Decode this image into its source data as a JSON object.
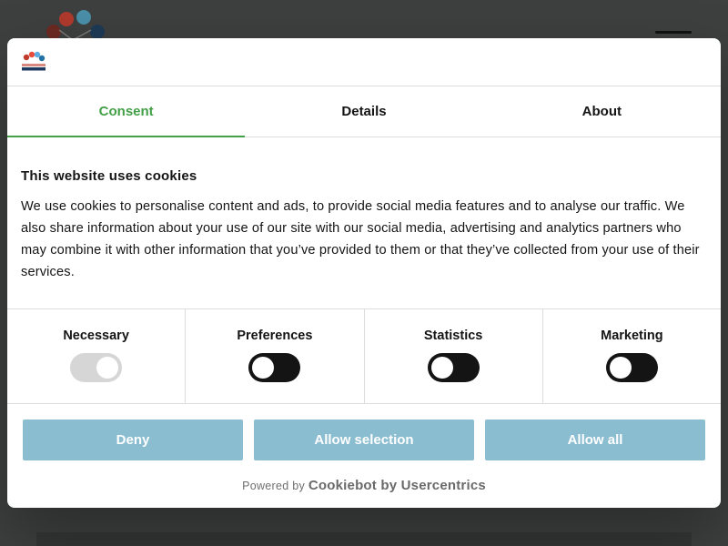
{
  "tabs": [
    {
      "label": "Consent",
      "active": true
    },
    {
      "label": "Details",
      "active": false
    },
    {
      "label": "About",
      "active": false
    }
  ],
  "content": {
    "title": "This website uses cookies",
    "body": "We use cookies to personalise content and ads, to provide social media features and to analyse our traffic. We also share information about your use of our site with our social media, advertising and analytics partners who may combine it with other information that you’ve provided to them or that they’ve collected from your use of their services."
  },
  "toggles": [
    {
      "label": "Necessary",
      "checked": true,
      "disabled": true
    },
    {
      "label": "Preferences",
      "checked": false,
      "disabled": false
    },
    {
      "label": "Statistics",
      "checked": false,
      "disabled": false
    },
    {
      "label": "Marketing",
      "checked": false,
      "disabled": false
    }
  ],
  "buttons": {
    "deny": "Deny",
    "allow_selection": "Allow selection",
    "allow_all": "Allow all"
  },
  "footer": {
    "powered_by": "Powered by",
    "brand": "Cookiebot by Usercentrics"
  },
  "colors": {
    "accent": "#43a047",
    "button": "#8bbdd1",
    "toggle_off": "#141414",
    "toggle_disabled": "#d6d6d6"
  }
}
